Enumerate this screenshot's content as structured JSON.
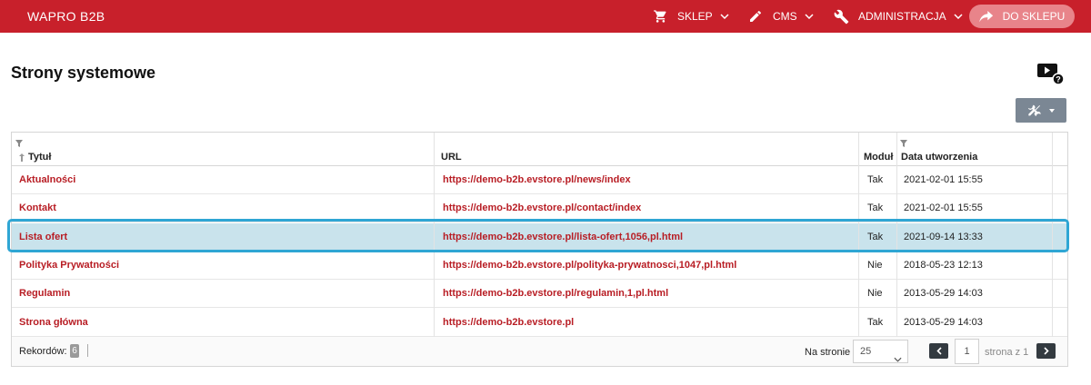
{
  "topbar": {
    "brand": "WAPRO B2B",
    "nav": [
      {
        "label": "SKLEP",
        "icon": "cart-icon"
      },
      {
        "label": "CMS",
        "icon": "pencil-icon"
      },
      {
        "label": "ADMINISTRACJA",
        "icon": "wrench-icon"
      }
    ],
    "shop_button": "DO SKLEPU"
  },
  "page": {
    "title": "Strony systemowe"
  },
  "table": {
    "columns": {
      "title": "Tytuł",
      "url": "URL",
      "module": "Moduł",
      "created": "Data utworzenia"
    },
    "rows": [
      {
        "title": "Aktualności",
        "url": "https://demo-b2b.evstore.pl/news/index",
        "module": "Tak",
        "created": "2021-02-01 15:55"
      },
      {
        "title": "Kontakt",
        "url": "https://demo-b2b.evstore.pl/contact/index",
        "module": "Tak",
        "created": "2021-02-01 15:55"
      },
      {
        "title": "Lista ofert",
        "url": "https://demo-b2b.evstore.pl/lista-ofert,1056,pl.html",
        "module": "Tak",
        "created": "2021-09-14 13:33"
      },
      {
        "title": "Polityka Prywatności",
        "url": "https://demo-b2b.evstore.pl/polityka-prywatnosci,1047,pl.html",
        "module": "Nie",
        "created": "2018-05-23 12:13"
      },
      {
        "title": "Regulamin",
        "url": "https://demo-b2b.evstore.pl/regulamin,1,pl.html",
        "module": "Nie",
        "created": "2013-05-29 14:03"
      },
      {
        "title": "Strona główna",
        "url": "https://demo-b2b.evstore.pl",
        "module": "Tak",
        "created": "2013-05-29 14:03"
      }
    ],
    "selected_row": 2
  },
  "footer": {
    "records_label": "Rekordów:",
    "records_count": "6",
    "per_page_label": "Na stronie",
    "per_page_value": "25",
    "page_value": "1",
    "page_of": "strona z 1"
  },
  "colors": {
    "topbar": "#c8202b",
    "link": "#b81d24",
    "selected_row": "#c9e3ec",
    "selected_outline": "#2fa6d4"
  }
}
